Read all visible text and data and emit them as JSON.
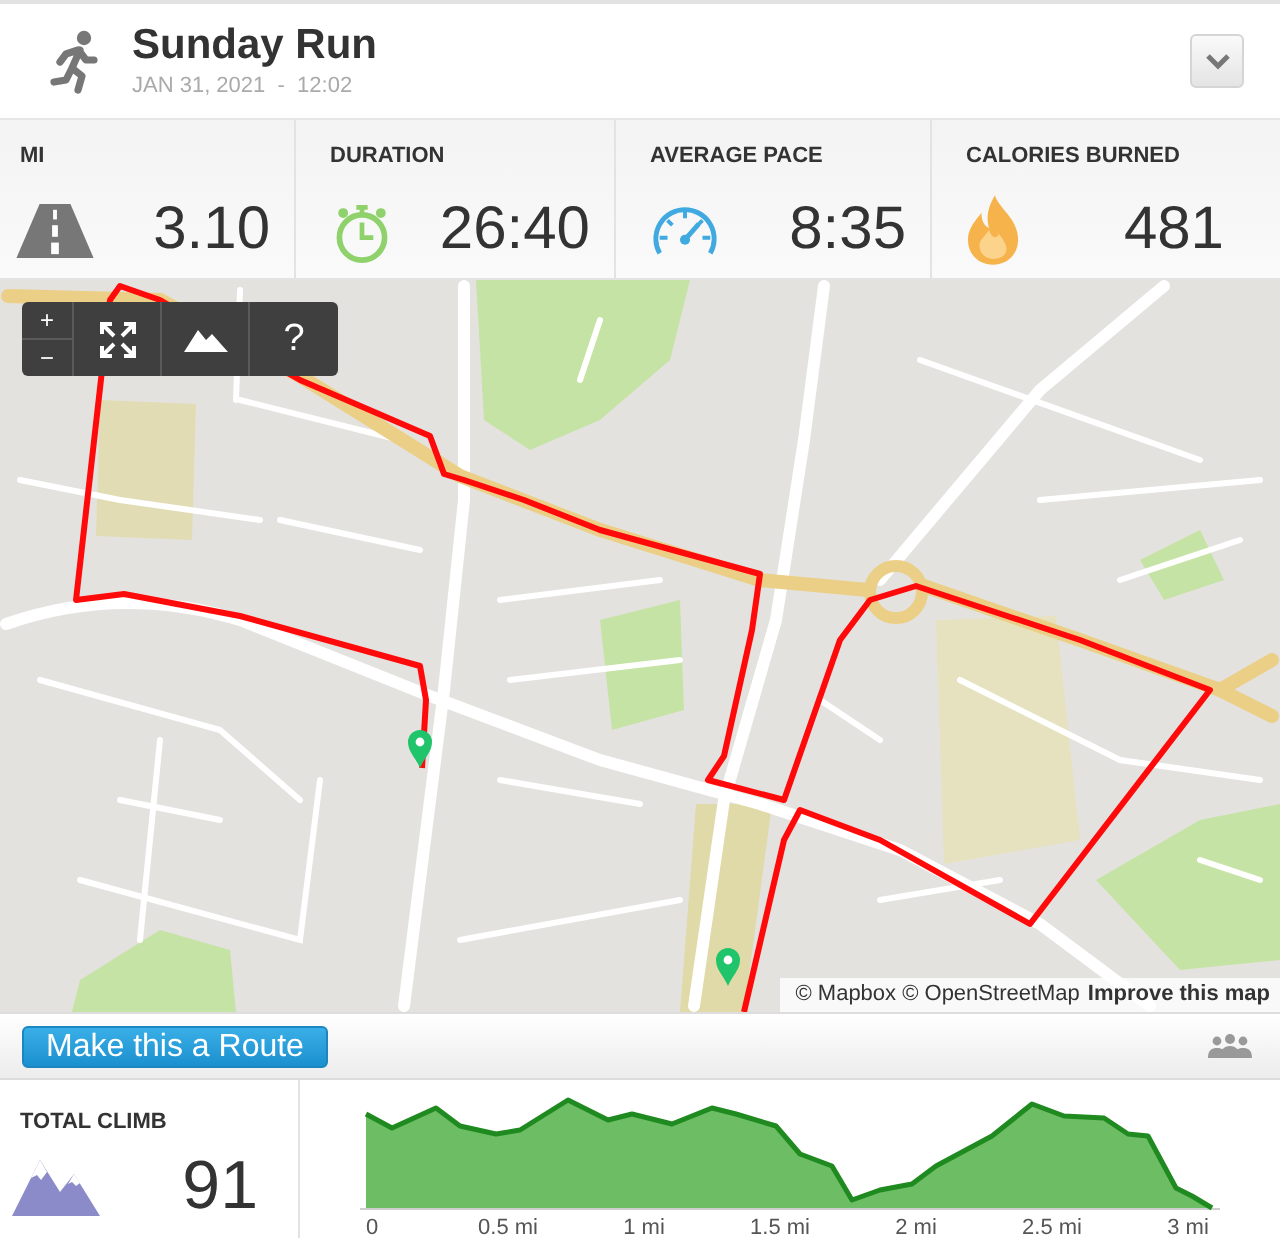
{
  "activity": {
    "title": "Sunday Run",
    "datetime": "JAN 31, 2021  -  12:02"
  },
  "stats": [
    {
      "kind": "distance",
      "label": "MI",
      "value": "3.10"
    },
    {
      "kind": "duration",
      "label": "DURATION",
      "value": "26:40"
    },
    {
      "kind": "pace",
      "label": "AVERAGE PACE",
      "value": "8:35"
    },
    {
      "kind": "calories",
      "label": "CALORIES BURNED",
      "value": "481"
    }
  ],
  "map": {
    "controls": [
      {
        "kind": "zoom",
        "zoom_in": "+",
        "zoom_out": "−"
      },
      {
        "kind": "fullscreen"
      },
      {
        "kind": "terrain"
      },
      {
        "kind": "help",
        "label": "?"
      }
    ],
    "attribution": "© Mapbox © OpenStreetMap",
    "improve_link": "Improve this map"
  },
  "route_button": "Make this a Route",
  "climb": {
    "label": "TOTAL CLIMB",
    "value": "91"
  },
  "elevation": {
    "axis_labels": [
      "0",
      "0.5 mi",
      "1 mi",
      "1.5 mi",
      "2 mi",
      "2.5 mi",
      "3 mi"
    ]
  }
}
